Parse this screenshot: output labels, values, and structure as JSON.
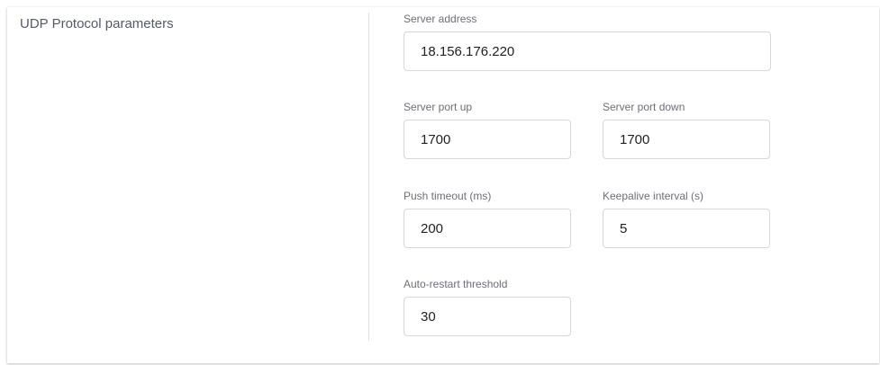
{
  "section": {
    "title": "UDP Protocol parameters"
  },
  "fields": {
    "server_address": {
      "label": "Server address",
      "value": "18.156.176.220"
    },
    "server_port_up": {
      "label": "Server port up",
      "value": "1700"
    },
    "server_port_down": {
      "label": "Server port down",
      "value": "1700"
    },
    "push_timeout": {
      "label": "Push timeout (ms)",
      "value": "200"
    },
    "keepalive_interval": {
      "label": "Keepalive interval (s)",
      "value": "5"
    },
    "auto_restart_threshold": {
      "label": "Auto-restart threshold",
      "value": "30"
    }
  }
}
